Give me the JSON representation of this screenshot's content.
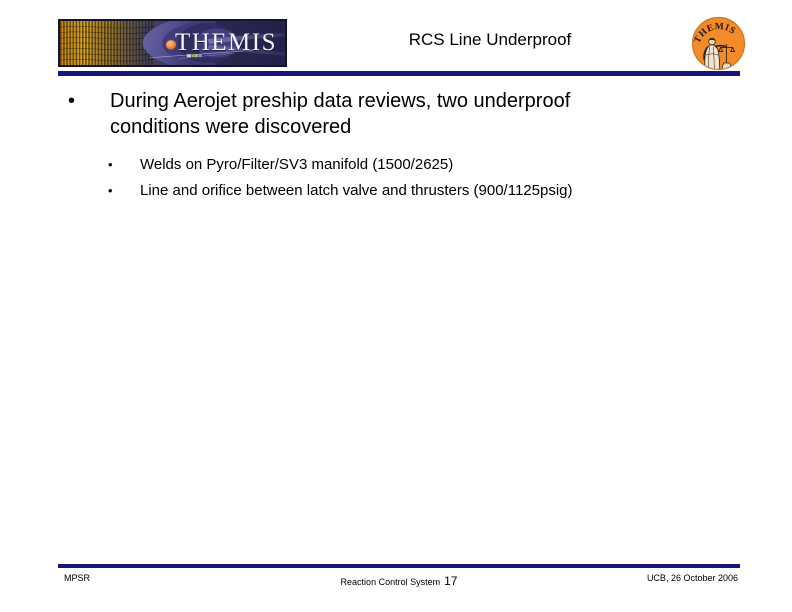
{
  "slide": {
    "title": "RCS Line Underproof",
    "colors": {
      "rule": "#15157a",
      "seal_orange": "#f28b2a",
      "banner_purple": "#4a4a8c",
      "banner_gold": "#d99b22",
      "text": "#000000",
      "background": "#ffffff"
    }
  },
  "header": {
    "banner_logo": {
      "wordmark": "THEMIS",
      "icon_name": "themis-magnetosphere-banner"
    },
    "seal": {
      "wordmark": "THEMIS",
      "icon_name": "themis-scales-seal"
    }
  },
  "content": {
    "bullets": [
      {
        "marker": "•",
        "text": "During Aerojet preship data reviews, two underproof conditions were discovered",
        "sub_bullets": [
          {
            "marker": "•",
            "text": "Welds on Pyro/Filter/SV3 manifold (1500/2625)"
          },
          {
            "marker": "•",
            "text": "Line and orifice between latch valve and thrusters (900/1125psig)"
          }
        ]
      }
    ]
  },
  "footer": {
    "left": "MPSR",
    "center_label": "Reaction Control System",
    "page_number": "17",
    "right": "UCB, 26 October 2006"
  }
}
